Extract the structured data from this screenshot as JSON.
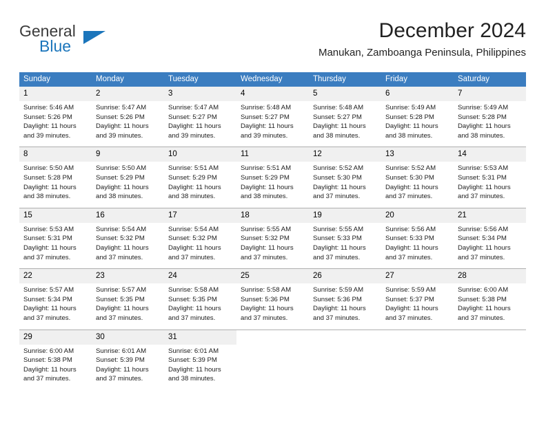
{
  "brand": {
    "name_part1": "General",
    "name_part2": "Blue",
    "accent_color": "#1b75bb"
  },
  "header": {
    "title": "December 2024",
    "subtitle": "Manukan, Zamboanga Peninsula, Philippines"
  },
  "calendar": {
    "header_bg": "#3b7dc0",
    "daynum_bg": "#f0f0f0",
    "weekdays": [
      "Sunday",
      "Monday",
      "Tuesday",
      "Wednesday",
      "Thursday",
      "Friday",
      "Saturday"
    ],
    "weeks": [
      [
        {
          "day": "1",
          "sunrise": "Sunrise: 5:46 AM",
          "sunset": "Sunset: 5:26 PM",
          "daylight_line1": "Daylight: 11 hours",
          "daylight_line2": "and 39 minutes."
        },
        {
          "day": "2",
          "sunrise": "Sunrise: 5:47 AM",
          "sunset": "Sunset: 5:26 PM",
          "daylight_line1": "Daylight: 11 hours",
          "daylight_line2": "and 39 minutes."
        },
        {
          "day": "3",
          "sunrise": "Sunrise: 5:47 AM",
          "sunset": "Sunset: 5:27 PM",
          "daylight_line1": "Daylight: 11 hours",
          "daylight_line2": "and 39 minutes."
        },
        {
          "day": "4",
          "sunrise": "Sunrise: 5:48 AM",
          "sunset": "Sunset: 5:27 PM",
          "daylight_line1": "Daylight: 11 hours",
          "daylight_line2": "and 39 minutes."
        },
        {
          "day": "5",
          "sunrise": "Sunrise: 5:48 AM",
          "sunset": "Sunset: 5:27 PM",
          "daylight_line1": "Daylight: 11 hours",
          "daylight_line2": "and 38 minutes."
        },
        {
          "day": "6",
          "sunrise": "Sunrise: 5:49 AM",
          "sunset": "Sunset: 5:28 PM",
          "daylight_line1": "Daylight: 11 hours",
          "daylight_line2": "and 38 minutes."
        },
        {
          "day": "7",
          "sunrise": "Sunrise: 5:49 AM",
          "sunset": "Sunset: 5:28 PM",
          "daylight_line1": "Daylight: 11 hours",
          "daylight_line2": "and 38 minutes."
        }
      ],
      [
        {
          "day": "8",
          "sunrise": "Sunrise: 5:50 AM",
          "sunset": "Sunset: 5:28 PM",
          "daylight_line1": "Daylight: 11 hours",
          "daylight_line2": "and 38 minutes."
        },
        {
          "day": "9",
          "sunrise": "Sunrise: 5:50 AM",
          "sunset": "Sunset: 5:29 PM",
          "daylight_line1": "Daylight: 11 hours",
          "daylight_line2": "and 38 minutes."
        },
        {
          "day": "10",
          "sunrise": "Sunrise: 5:51 AM",
          "sunset": "Sunset: 5:29 PM",
          "daylight_line1": "Daylight: 11 hours",
          "daylight_line2": "and 38 minutes."
        },
        {
          "day": "11",
          "sunrise": "Sunrise: 5:51 AM",
          "sunset": "Sunset: 5:29 PM",
          "daylight_line1": "Daylight: 11 hours",
          "daylight_line2": "and 38 minutes."
        },
        {
          "day": "12",
          "sunrise": "Sunrise: 5:52 AM",
          "sunset": "Sunset: 5:30 PM",
          "daylight_line1": "Daylight: 11 hours",
          "daylight_line2": "and 37 minutes."
        },
        {
          "day": "13",
          "sunrise": "Sunrise: 5:52 AM",
          "sunset": "Sunset: 5:30 PM",
          "daylight_line1": "Daylight: 11 hours",
          "daylight_line2": "and 37 minutes."
        },
        {
          "day": "14",
          "sunrise": "Sunrise: 5:53 AM",
          "sunset": "Sunset: 5:31 PM",
          "daylight_line1": "Daylight: 11 hours",
          "daylight_line2": "and 37 minutes."
        }
      ],
      [
        {
          "day": "15",
          "sunrise": "Sunrise: 5:53 AM",
          "sunset": "Sunset: 5:31 PM",
          "daylight_line1": "Daylight: 11 hours",
          "daylight_line2": "and 37 minutes."
        },
        {
          "day": "16",
          "sunrise": "Sunrise: 5:54 AM",
          "sunset": "Sunset: 5:32 PM",
          "daylight_line1": "Daylight: 11 hours",
          "daylight_line2": "and 37 minutes."
        },
        {
          "day": "17",
          "sunrise": "Sunrise: 5:54 AM",
          "sunset": "Sunset: 5:32 PM",
          "daylight_line1": "Daylight: 11 hours",
          "daylight_line2": "and 37 minutes."
        },
        {
          "day": "18",
          "sunrise": "Sunrise: 5:55 AM",
          "sunset": "Sunset: 5:32 PM",
          "daylight_line1": "Daylight: 11 hours",
          "daylight_line2": "and 37 minutes."
        },
        {
          "day": "19",
          "sunrise": "Sunrise: 5:55 AM",
          "sunset": "Sunset: 5:33 PM",
          "daylight_line1": "Daylight: 11 hours",
          "daylight_line2": "and 37 minutes."
        },
        {
          "day": "20",
          "sunrise": "Sunrise: 5:56 AM",
          "sunset": "Sunset: 5:33 PM",
          "daylight_line1": "Daylight: 11 hours",
          "daylight_line2": "and 37 minutes."
        },
        {
          "day": "21",
          "sunrise": "Sunrise: 5:56 AM",
          "sunset": "Sunset: 5:34 PM",
          "daylight_line1": "Daylight: 11 hours",
          "daylight_line2": "and 37 minutes."
        }
      ],
      [
        {
          "day": "22",
          "sunrise": "Sunrise: 5:57 AM",
          "sunset": "Sunset: 5:34 PM",
          "daylight_line1": "Daylight: 11 hours",
          "daylight_line2": "and 37 minutes."
        },
        {
          "day": "23",
          "sunrise": "Sunrise: 5:57 AM",
          "sunset": "Sunset: 5:35 PM",
          "daylight_line1": "Daylight: 11 hours",
          "daylight_line2": "and 37 minutes."
        },
        {
          "day": "24",
          "sunrise": "Sunrise: 5:58 AM",
          "sunset": "Sunset: 5:35 PM",
          "daylight_line1": "Daylight: 11 hours",
          "daylight_line2": "and 37 minutes."
        },
        {
          "day": "25",
          "sunrise": "Sunrise: 5:58 AM",
          "sunset": "Sunset: 5:36 PM",
          "daylight_line1": "Daylight: 11 hours",
          "daylight_line2": "and 37 minutes."
        },
        {
          "day": "26",
          "sunrise": "Sunrise: 5:59 AM",
          "sunset": "Sunset: 5:36 PM",
          "daylight_line1": "Daylight: 11 hours",
          "daylight_line2": "and 37 minutes."
        },
        {
          "day": "27",
          "sunrise": "Sunrise: 5:59 AM",
          "sunset": "Sunset: 5:37 PM",
          "daylight_line1": "Daylight: 11 hours",
          "daylight_line2": "and 37 minutes."
        },
        {
          "day": "28",
          "sunrise": "Sunrise: 6:00 AM",
          "sunset": "Sunset: 5:38 PM",
          "daylight_line1": "Daylight: 11 hours",
          "daylight_line2": "and 37 minutes."
        }
      ],
      [
        {
          "day": "29",
          "sunrise": "Sunrise: 6:00 AM",
          "sunset": "Sunset: 5:38 PM",
          "daylight_line1": "Daylight: 11 hours",
          "daylight_line2": "and 37 minutes."
        },
        {
          "day": "30",
          "sunrise": "Sunrise: 6:01 AM",
          "sunset": "Sunset: 5:39 PM",
          "daylight_line1": "Daylight: 11 hours",
          "daylight_line2": "and 37 minutes."
        },
        {
          "day": "31",
          "sunrise": "Sunrise: 6:01 AM",
          "sunset": "Sunset: 5:39 PM",
          "daylight_line1": "Daylight: 11 hours",
          "daylight_line2": "and 38 minutes."
        },
        {
          "day": "",
          "sunrise": "",
          "sunset": "",
          "daylight_line1": "",
          "daylight_line2": ""
        },
        {
          "day": "",
          "sunrise": "",
          "sunset": "",
          "daylight_line1": "",
          "daylight_line2": ""
        },
        {
          "day": "",
          "sunrise": "",
          "sunset": "",
          "daylight_line1": "",
          "daylight_line2": ""
        },
        {
          "day": "",
          "sunrise": "",
          "sunset": "",
          "daylight_line1": "",
          "daylight_line2": ""
        }
      ]
    ]
  }
}
